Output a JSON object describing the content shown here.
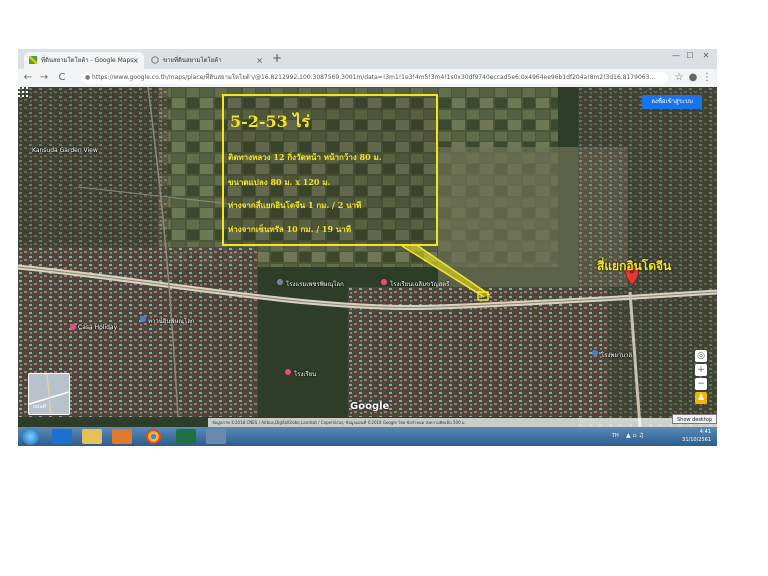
{
  "browser": {
    "tabs": [
      {
        "label": "ที่ดินสยามโตโยต้า - Google Maps",
        "active": true
      },
      {
        "label": "ขายที่ดินสยามโตโยต้า",
        "active": false
      }
    ],
    "new_tab_label": "+",
    "window_buttons": [
      "—",
      "☐",
      "✕"
    ],
    "address": "https://www.google.co.th/maps/place/ที่ดินสยามโตโยต้า/@16.8212992,100.3087569,3001m/data=!3m1!1e3!4m5!3m4!1s0x30df9740eccad5e6:0x4964ee96b1df204a!8m2!3d16.8179063...",
    "nav": {
      "back": "←",
      "forward": "→",
      "reload": "C",
      "star": "☆",
      "profile": "●",
      "menu": "⋮"
    }
  },
  "map": {
    "sign_in_label": "ลงชื่อเข้าสู่ระบบ",
    "infobox": {
      "area": "5-2-53 ไร่",
      "lines": [
        "ติดทางหลวง 12 กิ่งวัดหน้า หน้ากว้าง 80 ม.",
        "ขนาดแปลง 80 ม. x 120 ม.",
        "ห่างจากสี่แยกอินโดจีน 1 กม. / 2 นาที",
        "ห่างจากเซ็นทรัล 10 กม. / 19 นาที"
      ]
    },
    "destination_label": "สี่แยกอินโดจีน",
    "place_labels": [
      "Kansuda Garden View",
      "Casa Holiday",
      "ทาวน์อินพิษณุโลก",
      "โรงแรมเพชรพิษณุโลก",
      "โรงเรียนเฉลิมขวัญสตรี",
      "โรงพยาบาล",
      "โรงเรียน"
    ],
    "google_logo": "Google",
    "minimap_label": "แผนที่",
    "zoom": {
      "in": "+",
      "out": "−"
    },
    "attribution": "ข้อมูลภาพ ©2018 CNES / Airbus,DigitalGlobe,Landsat / Copernicus, ข้อมูลแผนที่ ©2018 Google   ไทย   ข้อกำหนด   ส่งความคิดเห็น   500 ม.",
    "show_desktop": "Show desktop"
  },
  "taskbar": {
    "lang": "TH",
    "time": "4:41",
    "date": "31/10/2561"
  },
  "colors": {
    "annotation_yellow": "#f4e523",
    "pin_red": "#e53935",
    "signin_blue": "#1a73e8"
  }
}
